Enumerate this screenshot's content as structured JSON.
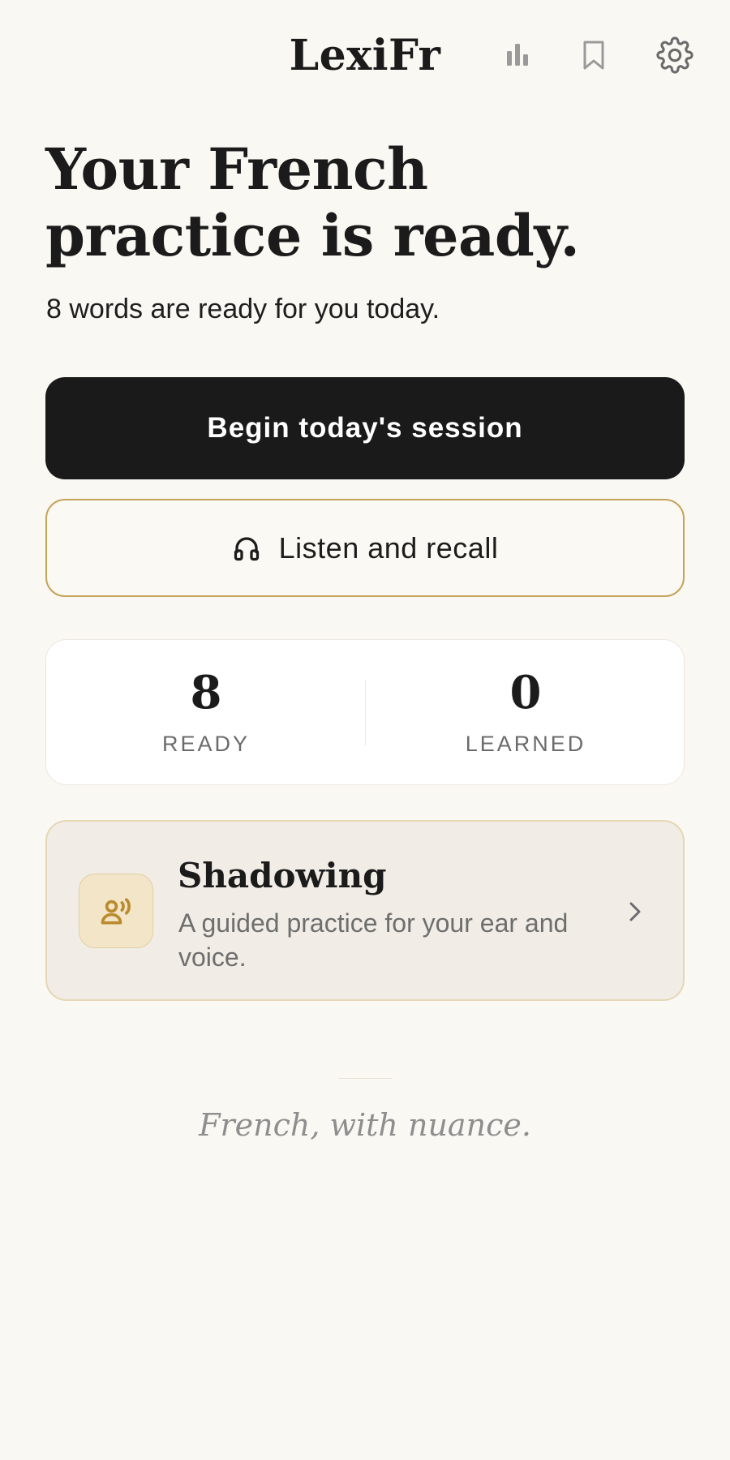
{
  "header": {
    "app_title": "LexiFr",
    "icons": [
      "bar-chart-icon",
      "bookmark-icon",
      "gear-icon"
    ]
  },
  "hero": {
    "title": "Your French practice is ready.",
    "subtitle": "8 words are ready for you today."
  },
  "actions": {
    "primary_label": "Begin today's session",
    "secondary_label": "Listen and recall",
    "secondary_icon": "headphones-icon"
  },
  "stats": {
    "ready_value": "8",
    "ready_label": "READY",
    "learned_value": "0",
    "learned_label": "LEARNED"
  },
  "shadowing": {
    "title": "Shadowing",
    "description": "A guided practice for your ear and voice.",
    "icon": "speaking-person-icon"
  },
  "footer": {
    "tagline": "French, with nuance."
  },
  "colors": {
    "background": "#faf8f3",
    "primary_button": "#1a1a1a",
    "accent_gold": "#c5a35a",
    "muted_text": "#6b6b6b"
  }
}
